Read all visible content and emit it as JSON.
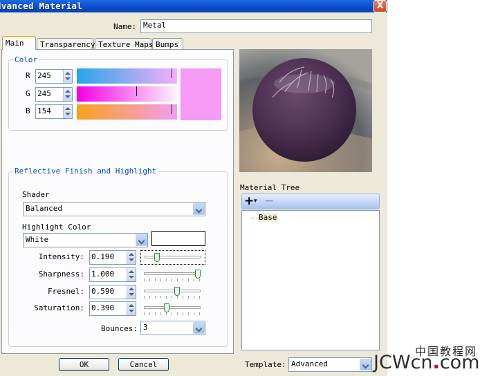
{
  "window": {
    "title": "dvanced Material",
    "close_glyph": "X"
  },
  "name_field": {
    "label": "Name:",
    "value": "Metal"
  },
  "tabs": [
    {
      "label": "Main",
      "active": true
    },
    {
      "label": "Transparency"
    },
    {
      "label": "Texture Maps"
    },
    {
      "label": "Bumps"
    }
  ],
  "color_group": {
    "title": "Color",
    "channels": [
      {
        "label": "R",
        "value": "245",
        "marker": 0.96,
        "gradient": [
          "#27a5ec",
          "#f7aefa"
        ]
      },
      {
        "label": "G",
        "value": "245",
        "marker": 0.6,
        "gradient": [
          "#f200e6",
          "#f9f5fb"
        ]
      },
      {
        "label": "B",
        "value": "154",
        "marker": 0.96,
        "gradient": [
          "#f7a21a",
          "#f39cf2"
        ]
      }
    ],
    "swatch_color": "#f59af5"
  },
  "reflective_group": {
    "title": "Reflective Finish and Highlight",
    "shader_label": "Shader",
    "shader_value": "Balanced",
    "highlight_label": "Highlight Color",
    "highlight_value": "White",
    "rows": [
      {
        "label": "Intensity:",
        "value": "0.190",
        "level": 0.19
      },
      {
        "label": "Sharpness:",
        "value": "1.000",
        "level": 1.0
      },
      {
        "label": "Fresnel:",
        "value": "0.590",
        "level": 0.59
      },
      {
        "label": "Saturation:",
        "value": "0.390",
        "level": 0.39
      }
    ],
    "bounces_label": "Bounces:",
    "bounces_value": "3"
  },
  "material_tree": {
    "label": "Material Tree",
    "add_glyph": "+",
    "add_dropdown_glyph": "▾",
    "remove_glyph": "−",
    "items": [
      {
        "label": "Base"
      }
    ]
  },
  "buttons": {
    "ok": "OK",
    "cancel": "Cancel"
  },
  "template": {
    "label": "Template:",
    "value": "Advanced"
  },
  "watermark": {
    "cn": "中国教程网",
    "en_a": "JCW",
    "en_b": "cn",
    "dot": ".",
    "en_c": "com"
  }
}
